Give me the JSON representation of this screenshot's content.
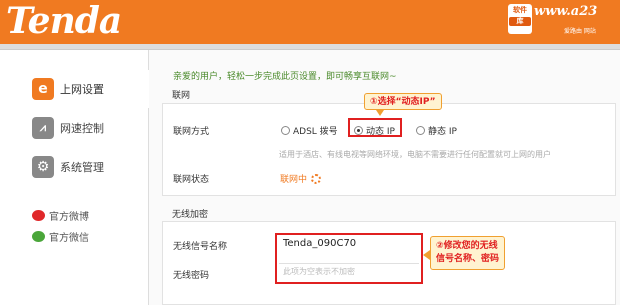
{
  "header": {
    "logo": "Tenda",
    "badge_top": "软件",
    "badge_bottom": "库",
    "site": "www.a23",
    "site_sub": "爱路由 网站"
  },
  "sidebar": {
    "items": [
      {
        "label": "上网设置",
        "icon": "e-icon"
      },
      {
        "label": "网速控制",
        "icon": "speed-icon"
      },
      {
        "label": "系统管理",
        "icon": "gear-icon"
      }
    ],
    "social": [
      {
        "label": "官方微博",
        "color": "#e0282a"
      },
      {
        "label": "官方微信",
        "color": "#4aa63a"
      }
    ]
  },
  "main": {
    "welcome": "亲爱的用户，轻松一步完成此页设置，即可畅享互联网~",
    "internet": {
      "section_title": "联网",
      "mode_label": "联网方式",
      "options": [
        "ADSL 拨号",
        "动态 IP",
        "静态 IP"
      ],
      "selected": "动态 IP",
      "hint": "适用于酒店、有线电视等网络环境，电脑不需要进行任何配置就可上网的用户",
      "status_label": "联网状态",
      "status_value": "联网中"
    },
    "wireless": {
      "section_title": "无线加密",
      "ssid_label": "无线信号名称",
      "ssid_value": "Tenda_090C70",
      "password_label": "无线密码",
      "password_placeholder": "此项为空表示不加密"
    },
    "callouts": {
      "select_dynamic": "①选择“动态IP”",
      "modify_line1": "②修改您的无线",
      "modify_line2": "信号名称、密码"
    }
  },
  "colors": {
    "brand": "#f07a21",
    "annotation": "#e02020",
    "welcome": "#4a8a2a"
  }
}
